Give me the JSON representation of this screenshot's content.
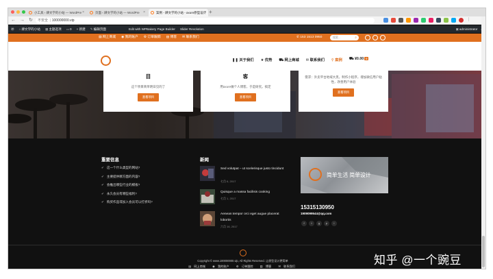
{
  "browser": {
    "tabs": [
      {
        "label": "小工具 ‹ 肆文学的小站 — WordPre"
      },
      {
        "label": "页面 ‹ 肆文学的小站 — WordPre"
      },
      {
        "label": "案例 - 肆文学的小站 - axure原型设计"
      }
    ],
    "url_security": "不安全",
    "url": "100000000.vip"
  },
  "admin_bar": {
    "site_name": "肆文学的小站",
    "theme_options": "主题选项",
    "comments_count": "0",
    "new": "+ 新建",
    "edit_page": "编辑页面",
    "wpbakery": "Edit with WPBakery Page Builder",
    "slider": "Slider Revolution",
    "user": "administrator"
  },
  "topbar": {
    "links": [
      "网上商城",
      "我的账户",
      "订单跟踪",
      "博客",
      "联系我们"
    ],
    "phone": "153 1513 0950",
    "search_placeholder": "搜索..."
  },
  "nav": {
    "items": [
      "关于我们",
      "优势",
      "网上商城",
      "联系我们",
      "案例",
      "¥0.00"
    ],
    "active_index": 4,
    "cart_count": "0"
  },
  "hero": {
    "cards": [
      {
        "title": "目",
        "desc": "这个项目简单明日见的了",
        "button": "查看项目"
      },
      {
        "title": "客",
        "desc": "用axure做个人博客，于是研究。搞定",
        "button": "查看项目"
      },
      {
        "title": "",
        "desc": "需求：外卖平台地域大黑，制作小程序，增加微信用户粘性，改善用户体验",
        "button": "查看项目"
      }
    ]
  },
  "footer": {
    "info_title": "重要信息",
    "info_items": [
      "这一个什么类型的网站?",
      "主要提供哪方面的内容?",
      "会推出哪些行业的模板?",
      "永久会员有哪些福利?",
      "购买作品或加入会员可以打折吗?"
    ],
    "news_title": "新闻",
    "news": [
      {
        "title": "Sed volutpat – ut scelerisque justo tincidunt",
        "date": "七月 6, 2017"
      },
      {
        "title": "Quisque a massa facilisis cooking",
        "date": "七月 1, 2017"
      },
      {
        "title": "Aenean tempor orci eget augue placerat lobortis",
        "date": "六月 16, 2017"
      }
    ],
    "promo_text": "简单生活 简单设计",
    "phone": "15315130950",
    "email": "1909099544@qq.com",
    "social": [
      "f",
      "t",
      "g",
      "p",
      "i"
    ]
  },
  "bottom": {
    "copyright": "Copyright © www.100000000.vip, All Rights Reserved. 让原型设计更简单",
    "links": [
      "网上商城",
      "我的账户",
      "订单跟踪",
      "博客",
      "联系我们"
    ]
  },
  "watermark": "知乎 @一个豌豆"
}
